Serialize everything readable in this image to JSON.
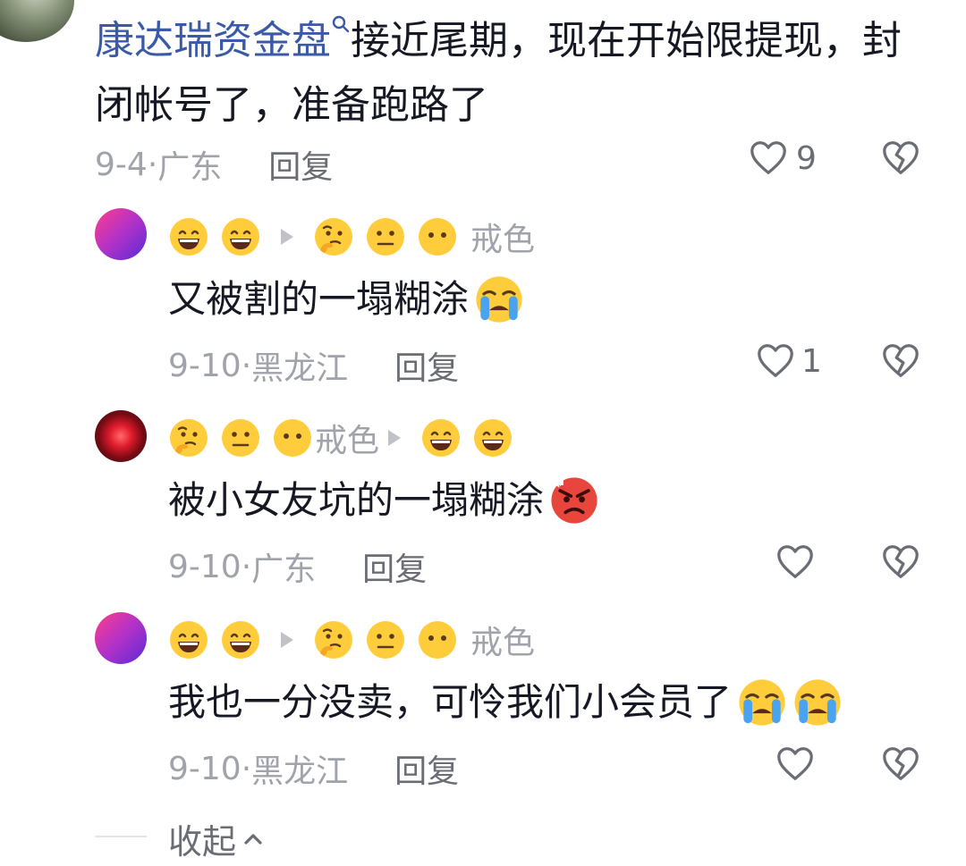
{
  "top_comment": {
    "username": "康达瑞资金盘",
    "text": "接近尾期，现在开始限提现，封闭帐号了，准备跑路了",
    "date": "9-4",
    "location": "广东",
    "reply_label": "回复",
    "likes": "9"
  },
  "replies": [
    {
      "tag_after": "戒色",
      "text": "又被割的一塌糊涂",
      "date": "9-10",
      "location": "黑龙江",
      "reply_label": "回复",
      "likes": "1"
    },
    {
      "tag_before": "戒色",
      "text": "被小女友坑的一塌糊涂",
      "date": "9-10",
      "location": "广东",
      "reply_label": "回复",
      "likes": ""
    },
    {
      "tag_after": "戒色",
      "text": "我也一分没卖，可怜我们小会员了",
      "date": "9-10",
      "location": "黑龙江",
      "reply_label": "回复",
      "likes": ""
    }
  ],
  "collapse_label": "收起",
  "colors": {
    "link": "#3a5aa8",
    "meta": "#a1a3ab"
  },
  "icons": [
    "search-icon",
    "heart-icon",
    "broken-heart-icon",
    "grinning-emoji",
    "thinking-emoji",
    "neutral-face-emoji",
    "no-mouth-emoji",
    "crying-emoji",
    "angry-emoji",
    "chevron-up-icon"
  ]
}
